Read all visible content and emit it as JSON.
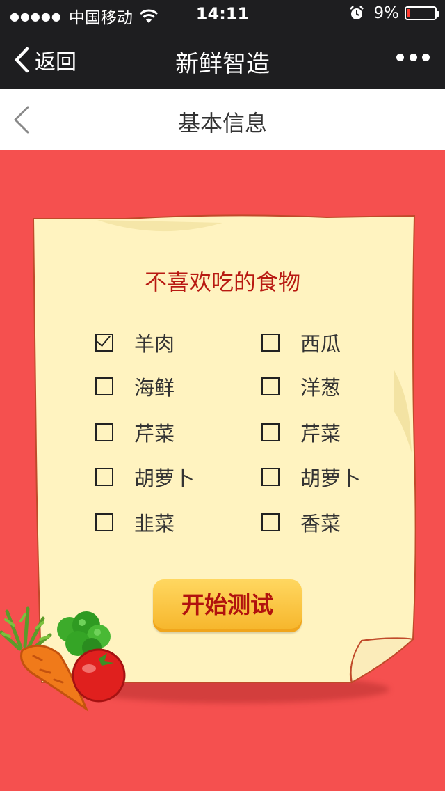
{
  "status_bar": {
    "signal": "●●●●●",
    "carrier": "中国移动",
    "time": "14:11",
    "battery_percent": "9%",
    "battery_level": 0.09,
    "icons": [
      "wifi-icon",
      "alarm-icon",
      "battery-icon"
    ]
  },
  "nav": {
    "back_label": "返回",
    "title": "新鲜智造",
    "more_icon": "more-dots-icon"
  },
  "header": {
    "title": "基本信息",
    "back_icon": "chevron-left-icon"
  },
  "card": {
    "title": "不喜欢吃的食物",
    "options": [
      {
        "label": "羊肉",
        "checked": true
      },
      {
        "label": "西瓜",
        "checked": false
      },
      {
        "label": "海鲜",
        "checked": false
      },
      {
        "label": "洋葱",
        "checked": false
      },
      {
        "label": "芹菜",
        "checked": false
      },
      {
        "label": "芹菜",
        "checked": false
      },
      {
        "label": "胡萝卜",
        "checked": false
      },
      {
        "label": "胡萝卜",
        "checked": false
      },
      {
        "label": "韭菜",
        "checked": false
      },
      {
        "label": "香菜",
        "checked": false
      }
    ],
    "start_button": "开始测试"
  },
  "colors": {
    "background": "#f5504f",
    "paper": "#fff3c0",
    "title_red": "#b81a12",
    "button_yellow": "#f6b52a"
  }
}
